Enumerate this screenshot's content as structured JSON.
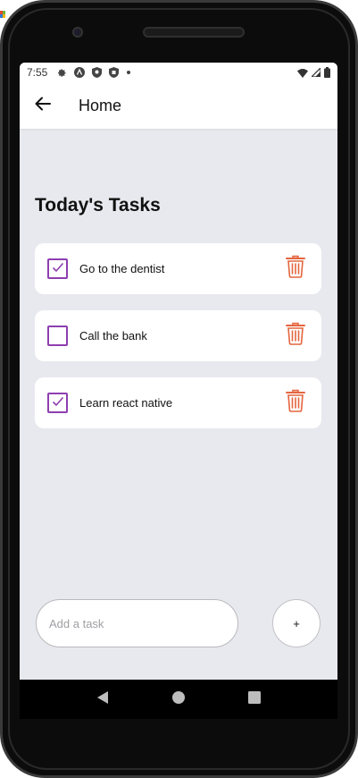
{
  "status_bar": {
    "time": "7:55",
    "icons_left": [
      "gear-icon",
      "app-icon-a",
      "shield-icon",
      "shield-icon",
      "dot-icon"
    ],
    "icons_right": [
      "wifi-icon",
      "signal-icon",
      "battery-icon"
    ]
  },
  "header": {
    "title": "Home"
  },
  "section": {
    "title": "Today's Tasks"
  },
  "tasks": [
    {
      "label": "Go to the dentist",
      "checked": true
    },
    {
      "label": "Call the bank",
      "checked": false
    },
    {
      "label": "Learn react native",
      "checked": true
    }
  ],
  "composer": {
    "placeholder": "Add a task",
    "value": "",
    "add_label": "+"
  },
  "colors": {
    "accent_purple": "#8e3fb0",
    "delete_orange": "#e4663f",
    "background": "#e8e9ee"
  }
}
